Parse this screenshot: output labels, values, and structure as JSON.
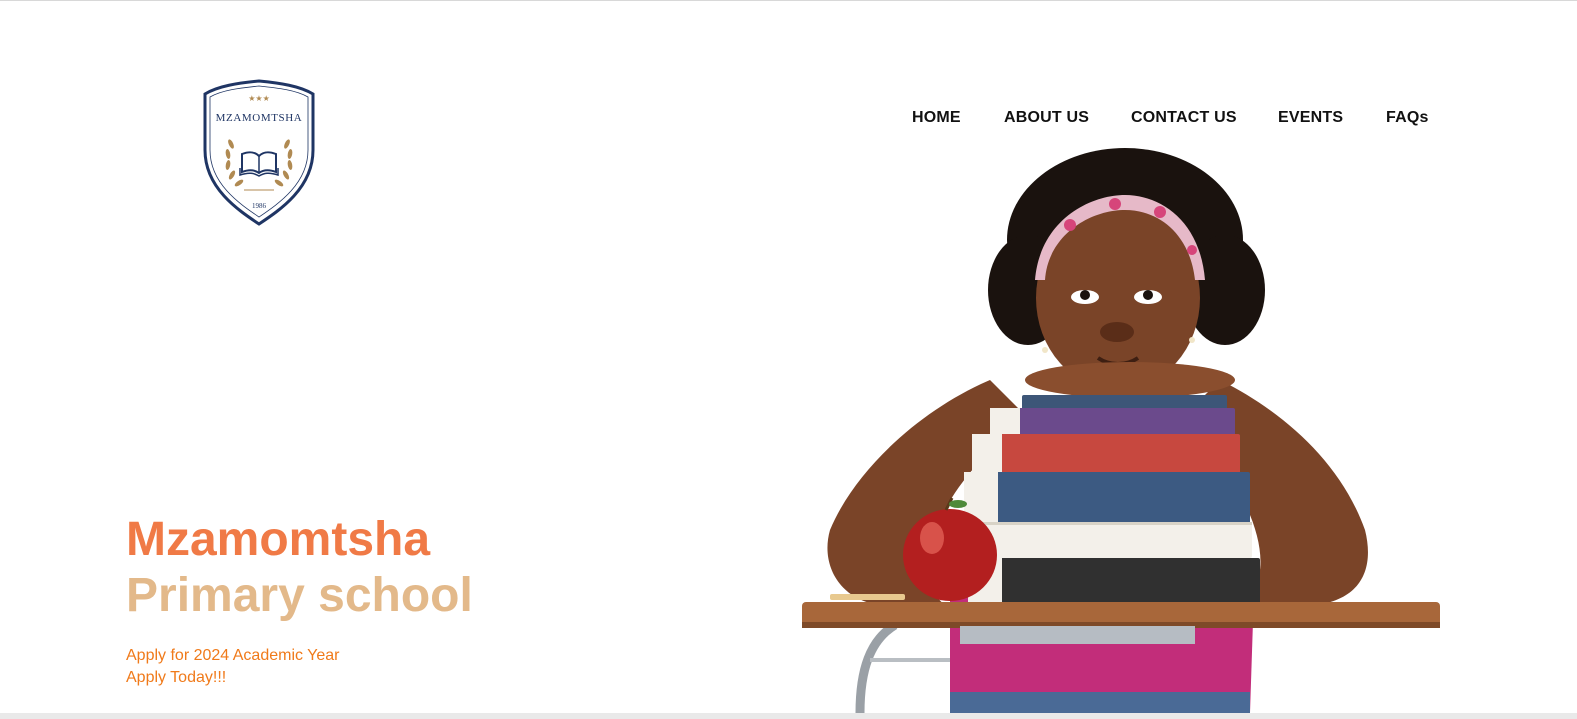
{
  "logo": {
    "name": "MZAMOMTSHA",
    "year": "1986",
    "colors": {
      "navy": "#1f3564",
      "gold": "#b08a52"
    }
  },
  "nav": {
    "items": [
      {
        "label": "HOME"
      },
      {
        "label": "ABOUT US"
      },
      {
        "label": "CONTACT US"
      },
      {
        "label": "EVENTS"
      },
      {
        "label": "FAQs"
      }
    ]
  },
  "hero": {
    "title_line1": "Mzamomtsha",
    "title_line2": "Primary school",
    "apply_line1": "Apply for 2024 Academic Year",
    "apply_line2": "Apply Today!!!",
    "colors": {
      "title1": "#f07a46",
      "title2": "#e3b98a",
      "apply": "#f07a1a"
    }
  }
}
